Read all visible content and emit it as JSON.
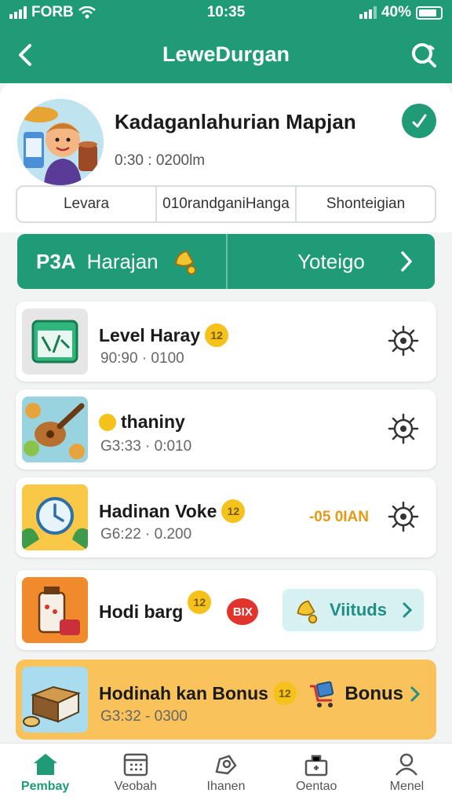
{
  "status_bar": {
    "carrier": "FORB",
    "time": "10:35",
    "battery": "40%"
  },
  "header": {
    "title": "LeweDurgan"
  },
  "profile": {
    "name": "Kadaganlahurian Mapjan",
    "subtitle": "0:30 : 0200lm",
    "tabs": [
      "Levara",
      "010randganiHanga",
      "Shonteigian"
    ]
  },
  "promo": {
    "left_tag": "P3A",
    "left_label": "Harajan",
    "right_label": "Yoteigo"
  },
  "items": [
    {
      "title": "Level Haray",
      "coin": "12",
      "meta": "90:90 · 0100"
    },
    {
      "title": "thaniny",
      "coin": "",
      "meta": "G3:33 · 0:010"
    },
    {
      "title": "Hadinan Voke",
      "coin": "12",
      "meta": "G6:22 · 0.200",
      "price": "-05 0IAN"
    },
    {
      "title": "Hodi barg",
      "coin": "12",
      "badge": "BIX",
      "action": "Viituds"
    },
    {
      "title": "Hodinah kan Bonus",
      "coin": "12",
      "meta": "G3:32 - 0300",
      "action": "Bonus"
    }
  ],
  "nav": [
    {
      "label": "Pembay"
    },
    {
      "label": "Veobah"
    },
    {
      "label": "Ihanen"
    },
    {
      "label": "Oentao"
    },
    {
      "label": "Menel"
    }
  ],
  "colors": {
    "brand": "#1f9b77",
    "bonus_bg": "#f9c25a",
    "coin": "#f4c21a",
    "price": "#e39a18"
  }
}
